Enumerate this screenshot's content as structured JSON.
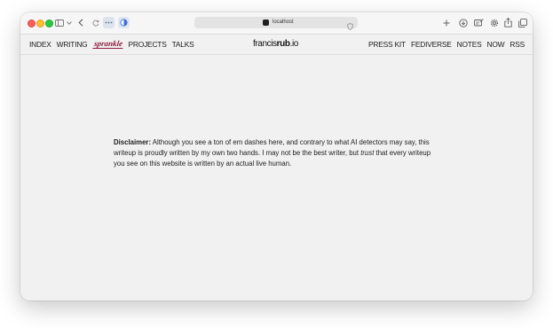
{
  "browser": {
    "url": "localhost",
    "icons": {
      "sidebar": "sidebar-icon",
      "chevron": "chevron-down-icon",
      "back": "back-arrow-icon",
      "forward": "forward-arrow-icon",
      "reload": "reload-icon",
      "extension_1": "ellipsis-extension-icon",
      "extension_2": "half-moon-extension-icon",
      "shield": "privacy-shield-icon",
      "new_tab": "plus-icon",
      "downloads": "download-icon",
      "reader": "reader-icon",
      "settings": "gear-icon",
      "share": "share-icon",
      "tabs": "tab-overview-icon"
    }
  },
  "nav": {
    "left": [
      "INDEX",
      "WRITING",
      "PROJECTS",
      "TALKS"
    ],
    "logo_word": "sprankle",
    "brand": {
      "part1": "francis",
      "part2": "rub",
      "part3": ".io"
    },
    "right": [
      "PRESS KIT",
      "FEDIVERSE",
      "NOTES",
      "NOW",
      "RSS"
    ]
  },
  "content": {
    "label": "Disclaimer:",
    "text_1": " Although you see a ton of em dashes here, and contrary to what AI detectors may say, this writeup is proudly written by my own two hands. I may not be the best writer, but ",
    "emphasis": "trust",
    "text_2": " that every writeup you see on this website is written by an actual live human."
  },
  "colors": {
    "accent": "#8d1b3d",
    "page_background": "#f1f1f1",
    "toolbar_background": "#f6f6f6"
  }
}
